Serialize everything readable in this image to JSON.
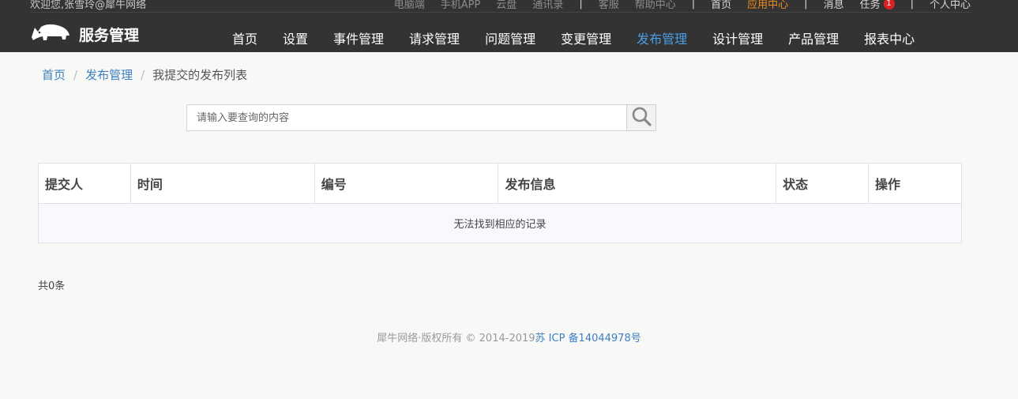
{
  "header": {
    "welcome": "欢迎您,张雪玲@犀牛网络",
    "links": [
      {
        "label": "电脑端",
        "tone": "muted"
      },
      {
        "label": "手机APP",
        "tone": "muted"
      },
      {
        "label": "云盘",
        "tone": "muted"
      },
      {
        "label": "通讯录",
        "tone": "muted"
      },
      {
        "label": "|",
        "tone": "sep"
      },
      {
        "label": "客服",
        "tone": "muted"
      },
      {
        "label": "帮助中心",
        "tone": "muted"
      },
      {
        "label": "|",
        "tone": "sep"
      },
      {
        "label": "首页",
        "tone": "light"
      },
      {
        "label": "应用中心",
        "tone": "orange"
      },
      {
        "label": "|",
        "tone": "sep"
      },
      {
        "label": "消息",
        "tone": "light"
      },
      {
        "label": "任务",
        "tone": "light",
        "badge": "1"
      },
      {
        "label": "|",
        "tone": "sep"
      },
      {
        "label": "个人中心",
        "tone": "light"
      }
    ],
    "logo_icon": "rhino-icon",
    "logo_text": "服务管理",
    "nav": [
      {
        "label": "首页"
      },
      {
        "label": "设置"
      },
      {
        "label": "事件管理"
      },
      {
        "label": "请求管理"
      },
      {
        "label": "问题管理"
      },
      {
        "label": "变更管理"
      },
      {
        "label": "发布管理",
        "active": true
      },
      {
        "label": "设计管理"
      },
      {
        "label": "产品管理"
      },
      {
        "label": "报表中心"
      }
    ],
    "colors": {
      "bar": "#333333",
      "active_nav": "#4a9ee8",
      "highlight": "#f08c1c",
      "badge": "#e02020"
    }
  },
  "breadcrumb": {
    "home": "首页",
    "section": "发布管理",
    "sep": "/",
    "current": "我提交的发布列表"
  },
  "search": {
    "placeholder": "请输入要查询的内容",
    "value": "",
    "icon": "search-icon"
  },
  "table": {
    "columns": [
      "提交人",
      "时间",
      "编号",
      "发布信息",
      "状态",
      "操作"
    ],
    "rows": [],
    "empty_text": "无法找到相应的记录"
  },
  "pagination": {
    "total": "共0条"
  },
  "footer": {
    "copyright": "犀牛网络·版权所有 © 2014-2019",
    "icp": "苏 ICP 备14044978号"
  }
}
